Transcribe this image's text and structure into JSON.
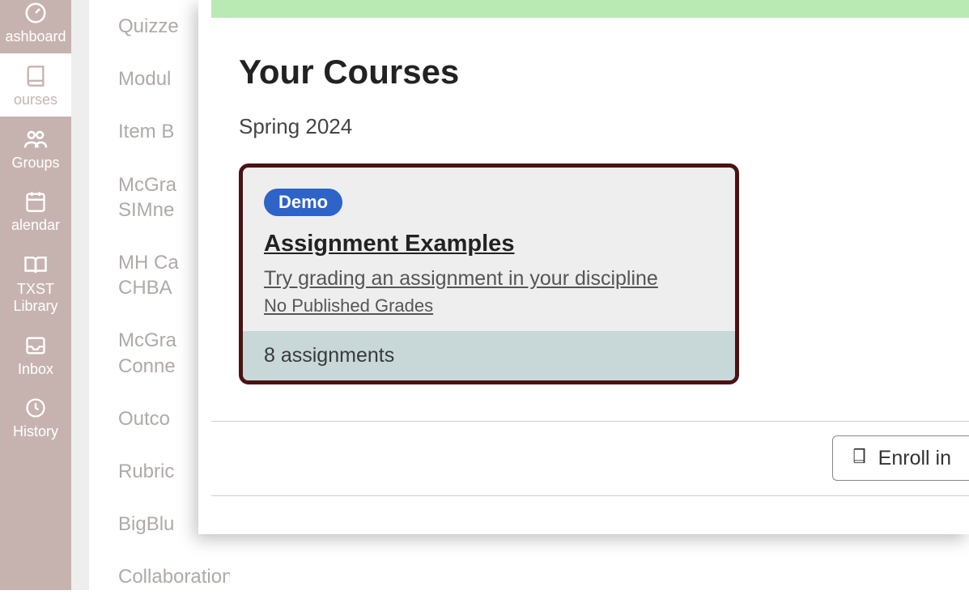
{
  "primaryNav": {
    "dashboard": "ashboard",
    "courses": "ourses",
    "groups": "Groups",
    "calendar": "alendar",
    "library": "TXST Library",
    "inbox": "Inbox",
    "history": "History"
  },
  "courseNav": {
    "quizzes": "Quizze",
    "modules": "Modul",
    "itemb": "Item B",
    "mcgrasim": "McGra SIMne",
    "mhca": "MH Ca CHBA",
    "mcgraconn": "McGra Conne",
    "outco": "Outco",
    "rubric": "Rubric",
    "bigblu": "BigBlu",
    "collaborations": "Collaborations"
  },
  "main": {
    "title": "Your Courses",
    "term": "Spring 2024",
    "card": {
      "badge": "Demo",
      "title": "Assignment Examples",
      "subtitle": "Try grading an assignment in your discipline",
      "grades": "No Published Grades",
      "footer": "8 assignments"
    },
    "enroll": "Enroll in"
  }
}
